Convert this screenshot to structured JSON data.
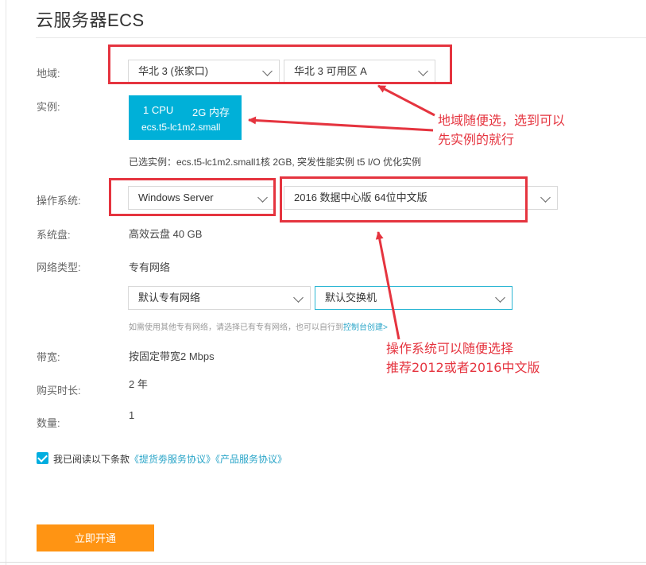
{
  "page_title": "云服务器ECS",
  "labels": {
    "region": "地域:",
    "instance": "实例:",
    "os": "操作系统:",
    "disk": "系统盘:",
    "network_type": "网络类型:",
    "bandwidth": "带宽:",
    "duration": "购买时长:",
    "quantity": "数量:"
  },
  "region": {
    "selected": "华北 3 (张家口)",
    "zone": "华北 3 可用区 A"
  },
  "instance": {
    "cpu": "1 CPU",
    "memory": "2G 内存",
    "code": "ecs.t5-lc1m2.small",
    "selected_text": "已选实例：ecs.t5-lc1m2.small1核 2GB, 突发性能实例 t5 I/O 优化实例"
  },
  "os": {
    "type": "Windows Server",
    "version": "2016 数据中心版 64位中文版"
  },
  "disk": "高效云盘 40 GB",
  "network": {
    "type": "专有网络",
    "vpc": "默认专有网络",
    "vswitch": "默认交换机",
    "hint": "如需使用其他专有网络，请选择已有专有网络，也可以自行到",
    "hint_link": "控制台创建>"
  },
  "bandwidth": "按固定带宽2 Mbps",
  "duration": "2 年",
  "quantity": "1",
  "agreement": {
    "checked": true,
    "text": "我已阅读以下条款",
    "link1": "《提货劵服务协议》",
    "link2": "《产品服务协议》"
  },
  "submit_label": "立即开通",
  "annotations": {
    "region_line1": "地域随便选，选到可以",
    "region_line2": "先实例的就行",
    "os_line1": "操作系统可以随便选择",
    "os_line2": "推荐2012或者2016中文版"
  },
  "colors": {
    "accent": "#00b0d8",
    "submit": "#ff9413",
    "annotation": "#e5343f"
  }
}
